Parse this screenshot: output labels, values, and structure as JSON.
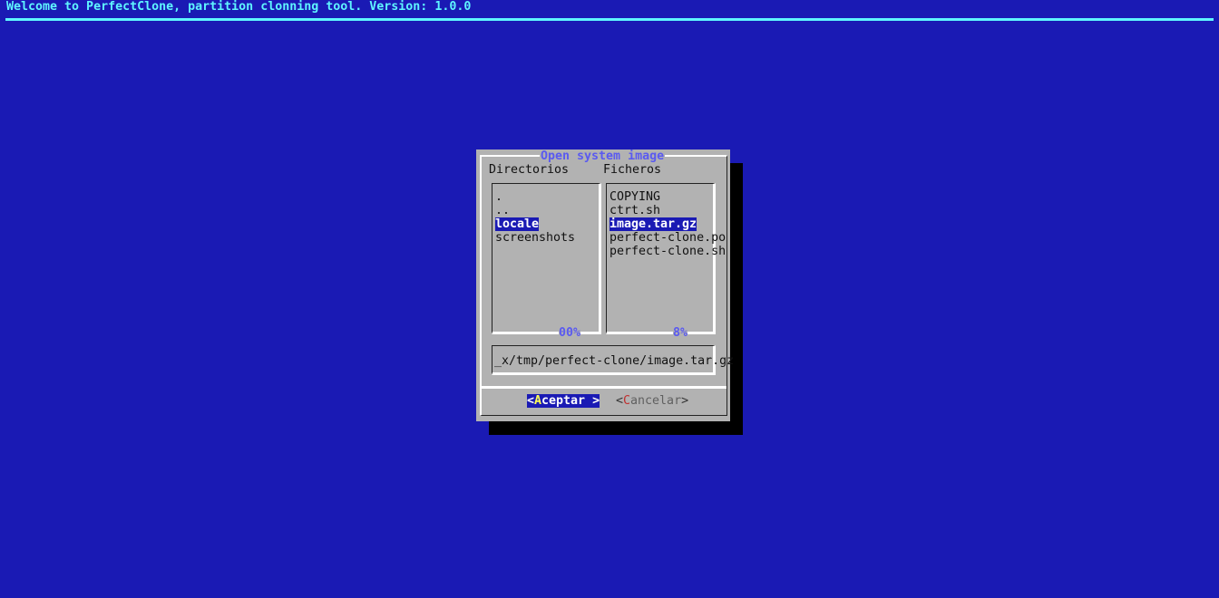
{
  "header": {
    "title": "Welcome to PerfectClone, partition clonning tool. Version: 1.0.0"
  },
  "dialog": {
    "title": "Open system image",
    "directories": {
      "label": "Directorios",
      "items": [
        ".",
        "..",
        "locale",
        "screenshots"
      ],
      "selected": "locale",
      "scroll_percent": "00%"
    },
    "files": {
      "label": "Ficheros",
      "items": [
        "COPYING",
        "ctrt.sh",
        "image.tar.gz",
        "perfect-clone.po",
        "perfect-clone.sh"
      ],
      "selected": "image.tar.gz",
      "scroll_percent": "8%"
    },
    "path_input": {
      "value": "_x/tmp/perfect-clone/image.tar.gz"
    },
    "buttons": {
      "ok_open": "<",
      "ok_hot": "A",
      "ok_rest": "ceptar >",
      "cancel_open": "<",
      "cancel_hot": "C",
      "cancel_rest": "ancelar",
      "cancel_close": ">"
    }
  },
  "colors": {
    "background": "#1a1ab4",
    "dialog": "#b2b2b2",
    "accent": "#5ff5ff",
    "title": "#5a5af0"
  }
}
